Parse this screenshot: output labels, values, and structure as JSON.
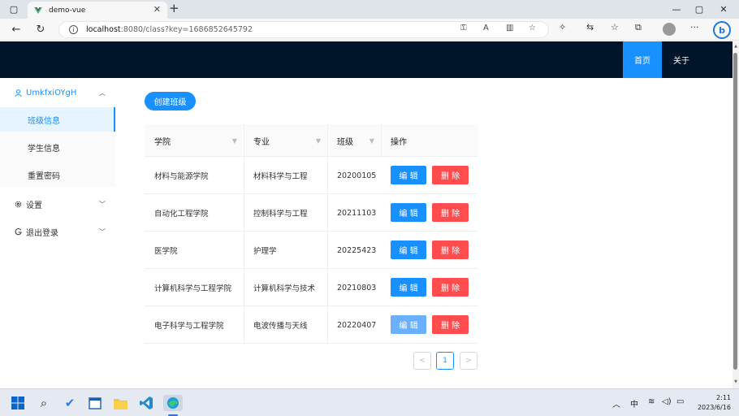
{
  "browser": {
    "tab_title": "demo-vue",
    "url_host": "localhost",
    "url_path": ":8080/class?key=1686852645792",
    "profile_icon": "profile-avatar-icon"
  },
  "header": {
    "nav": [
      "首页",
      "关于"
    ],
    "active_nav": "首页",
    "bg_color": "#001529",
    "accent": "#1890ff"
  },
  "sidebar": {
    "user": "UmkfxiOYgH",
    "user_items": [
      "班级信息",
      "学生信息",
      "重置密码"
    ],
    "selected_item": "班级信息",
    "settings": "设置",
    "logout": "退出登录"
  },
  "main": {
    "create_button": "创建班级",
    "table": {
      "columns": [
        "学院",
        "专业",
        "班级",
        "操作"
      ],
      "rows": [
        {
          "college": "材料与能源学院",
          "major": "材料科学与工程",
          "class": "20200105"
        },
        {
          "college": "自动化工程学院",
          "major": "控制科学与工程",
          "class": "20211103"
        },
        {
          "college": "医学院",
          "major": "护理学",
          "class": "20225423"
        },
        {
          "college": "计算机科学与工程学院",
          "major": "计算机科学与技术",
          "class": "20210803"
        },
        {
          "college": "电子科学与工程学院",
          "major": "电波传播与天线",
          "class": "20220407"
        }
      ],
      "edit_label": "编 辑",
      "delete_label": "删 除"
    },
    "pagination": {
      "current_page": "1",
      "prev": "<",
      "next": ">"
    }
  },
  "taskbar": {
    "ime": "中",
    "time": "2:11",
    "date": "2023/6/16"
  }
}
